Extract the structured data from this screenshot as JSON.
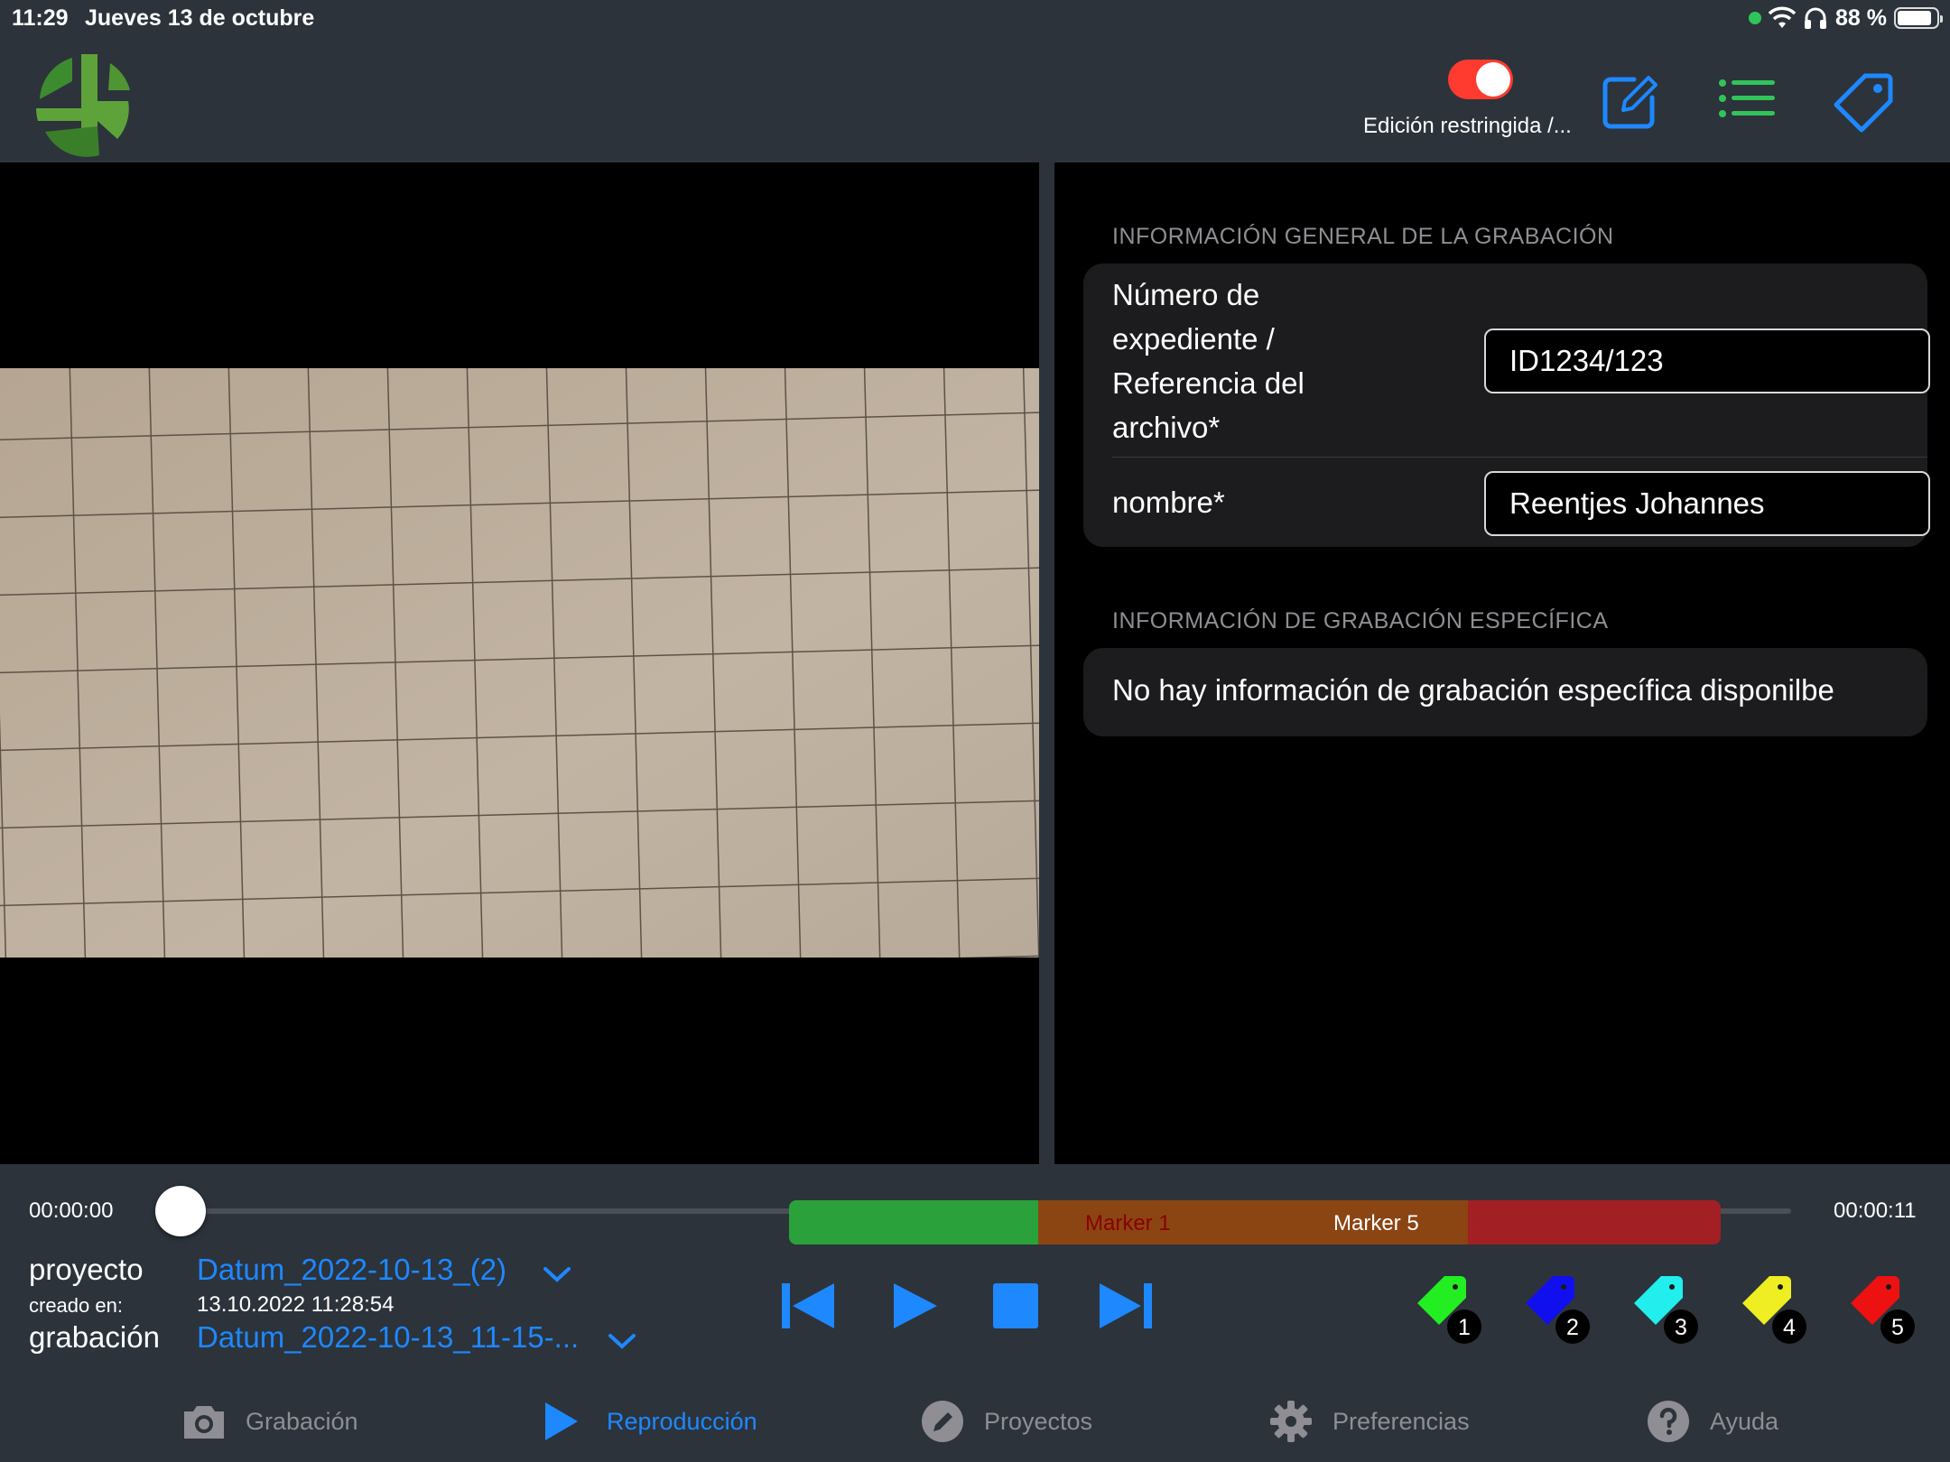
{
  "status_bar": {
    "time": "11:29",
    "date": "Jueves 13 de octubre",
    "battery_pct": "88 %",
    "battery_level": 0.88
  },
  "header": {
    "toggle_label": "Edición restringida /...",
    "toggle_on": true,
    "icons": [
      "edit-icon",
      "list-icon",
      "tag-icon"
    ]
  },
  "info": {
    "general_title": "INFORMACIÓN GENERAL DE LA GRABACIÓN",
    "fields": [
      {
        "label_lines": [
          "Número de",
          "expediente /",
          "Referencia del",
          "archivo*"
        ],
        "value": "ID1234/123"
      },
      {
        "label": "nombre*",
        "value": "Reentjes Johannes"
      }
    ],
    "specific_title": "INFORMACIÓN DE GRABACIÓN ESPECÍFICA",
    "specific_empty": "No hay información de grabación específica disponilbe"
  },
  "player": {
    "time_start": "00:00:00",
    "time_end": "00:00:11",
    "position": 0.0,
    "markers": [
      {
        "label": "Marker 1",
        "color": "#8b0000"
      },
      {
        "label": "Marker 5",
        "color": "#ffffff"
      }
    ],
    "segment_colors": {
      "green": "#2aa13b",
      "brown": "#8b4513",
      "red": "#a21f24"
    }
  },
  "meta": {
    "project_label": "proyecto",
    "project_value": "Datum_2022-10-13_(2)",
    "created_label": "creado en:",
    "created_value": "13.10.2022 11:28:54",
    "recording_label": "grabación",
    "recording_value": "Datum_2022-10-13_11-15-..."
  },
  "controls": [
    "skip-back-icon",
    "play-icon",
    "stop-icon",
    "skip-forward-icon"
  ],
  "tags": [
    {
      "number": "1",
      "color": "#22ee22"
    },
    {
      "number": "2",
      "color": "#1010ee"
    },
    {
      "number": "3",
      "color": "#22eeee"
    },
    {
      "number": "4",
      "color": "#eeee22"
    },
    {
      "number": "5",
      "color": "#ee1111"
    }
  ],
  "tabs": [
    {
      "label": "Grabación",
      "icon": "camera-icon",
      "active": false
    },
    {
      "label": "Reproducción",
      "icon": "play-icon",
      "active": true
    },
    {
      "label": "Proyectos",
      "icon": "pencil-icon",
      "active": false
    },
    {
      "label": "Preferencias",
      "icon": "gear-icon",
      "active": false
    },
    {
      "label": "Ayuda",
      "icon": "help-icon",
      "active": false
    }
  ],
  "colors": {
    "accent": "#1e88ff",
    "background": "#2c333b",
    "toggle": "#ff3b30",
    "list_icon": "#31c45a"
  }
}
